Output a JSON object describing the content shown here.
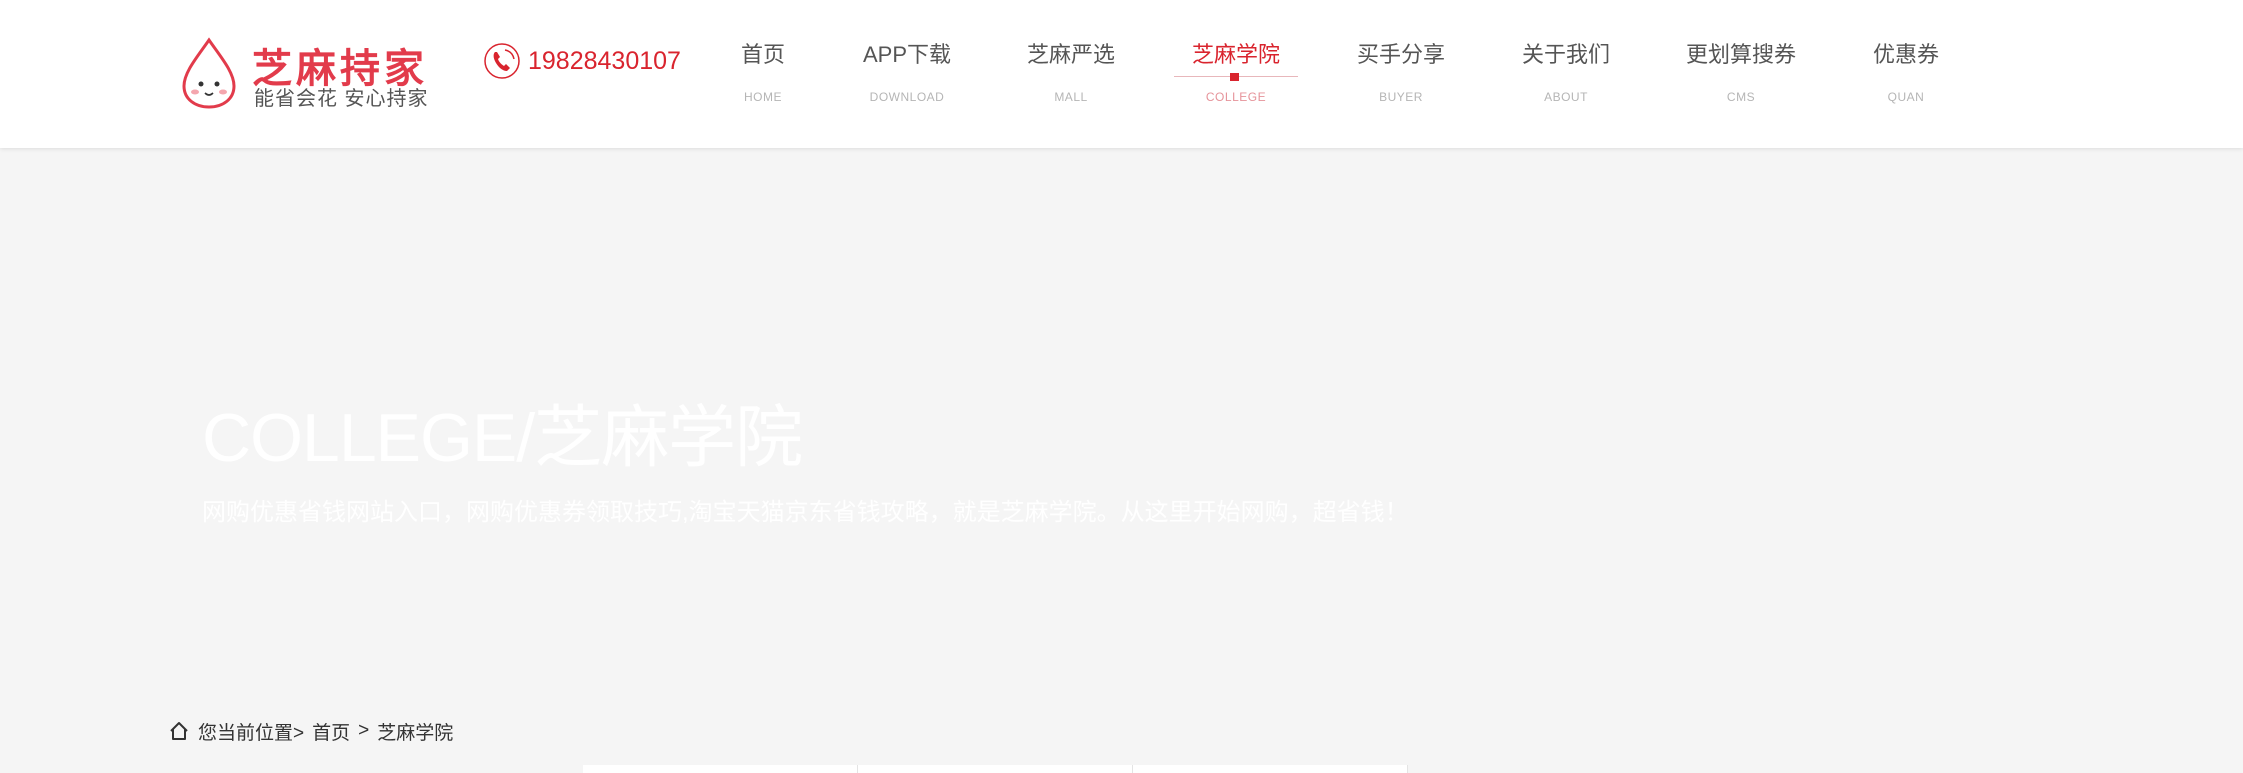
{
  "header": {
    "logo": {
      "title": "芝麻持家",
      "slogan": "能省会花 安心持家"
    },
    "phone": {
      "icon": "phone-icon",
      "number": "19828430107"
    },
    "nav": [
      {
        "label": "首页",
        "sub": "HOME"
      },
      {
        "label": "APP下载",
        "sub": "DOWNLOAD"
      },
      {
        "label": "芝麻严选",
        "sub": "MALL"
      },
      {
        "label": "芝麻学院",
        "sub": "COLLEGE",
        "active": true
      },
      {
        "label": "买手分享",
        "sub": "BUYER"
      },
      {
        "label": "关于我们",
        "sub": "ABOUT"
      },
      {
        "label": "更划算搜券",
        "sub": "CMS"
      },
      {
        "label": "优惠券",
        "sub": "QUAN"
      }
    ]
  },
  "banner": {
    "title": "COLLEGE/芝麻学院",
    "description": "网购优惠省钱网站入口，网购优惠券领取技巧,淘宝天猫京东省钱攻略，就是芝麻学院。从这里开始网购，超省钱！"
  },
  "breadcrumb": {
    "icon": "home-icon",
    "prefix": "您当前位置>",
    "home": "首页",
    "separator": ">",
    "current": "芝麻学院"
  },
  "colors": {
    "brand_red": "#d9242e",
    "logo_red": "#e23b4b",
    "background": "#f5f5f5"
  }
}
